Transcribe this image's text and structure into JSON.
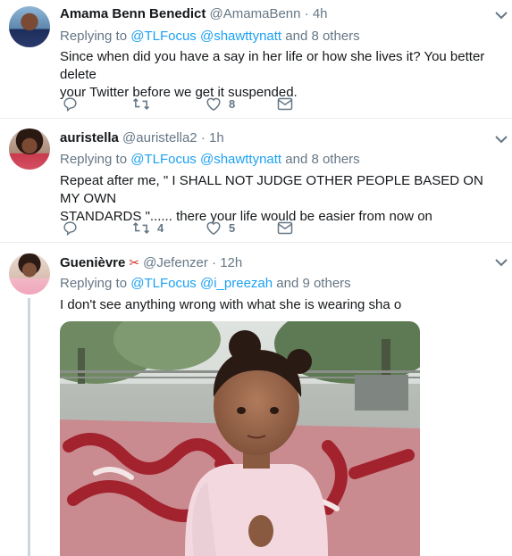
{
  "tweets": [
    {
      "name": "Amama Benn Benedict",
      "handle": "@AmamaBenn",
      "time": "· 4h",
      "replying_to": "Replying to",
      "mentions": [
        "@TLFocus",
        "@shawttynatt"
      ],
      "others": "and 8 others",
      "text_line1": "Since when did you have a say in her life or how she lives it? You better delete",
      "text_line2": "your Twitter before we get it suspended.",
      "reply_count": "",
      "retweet_count": "",
      "like_count": "8"
    },
    {
      "name": "auristella",
      "handle": "@auristella2",
      "time": "· 1h",
      "replying_to": "Replying to",
      "mentions": [
        "@TLFocus",
        "@shawttynatt"
      ],
      "others": "and 8 others",
      "text_line1": "Repeat after me, \" I SHALL NOT JUDGE OTHER PEOPLE BASED ON MY OWN",
      "text_line2": "STANDARDS \"...... there your life would be easier from now on",
      "reply_count": "",
      "retweet_count": "4",
      "like_count": "5"
    },
    {
      "name": "Guenièvre",
      "name_emoji": "✂",
      "handle": "@Jefenzer",
      "time": "· 12h",
      "replying_to": "Replying to",
      "mentions": [
        "@TLFocus",
        "@i_preezah"
      ],
      "others": "and 9 others",
      "text_line1": "I don't see anything wrong with what she is wearing sha o"
    }
  ],
  "colors": {
    "link": "#1da1f2",
    "secondary": "#657786",
    "separator": "#e6ecf0",
    "thread": "#ccd6dd"
  }
}
